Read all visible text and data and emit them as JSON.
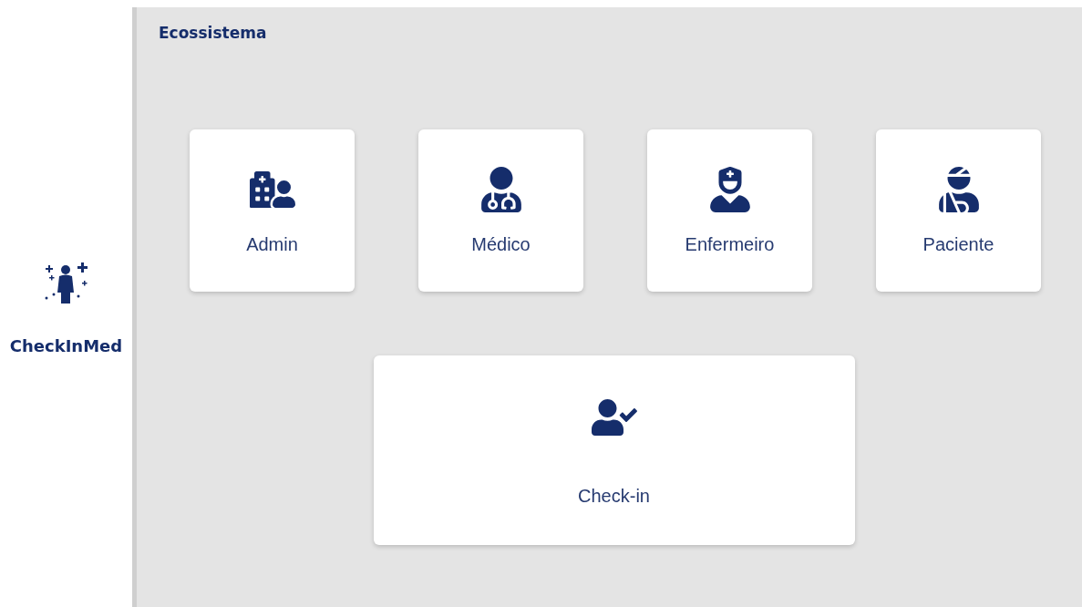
{
  "brand": {
    "name": "CheckInMed"
  },
  "page": {
    "title": "Ecossistema"
  },
  "cards": [
    {
      "kind": "admin",
      "label": "Admin"
    },
    {
      "kind": "doctor",
      "label": "Médico"
    },
    {
      "kind": "nurse",
      "label": "Enfermeiro"
    },
    {
      "kind": "patient",
      "label": "Paciente"
    }
  ],
  "wide_card": {
    "kind": "checkin",
    "label": "Check-in"
  }
}
